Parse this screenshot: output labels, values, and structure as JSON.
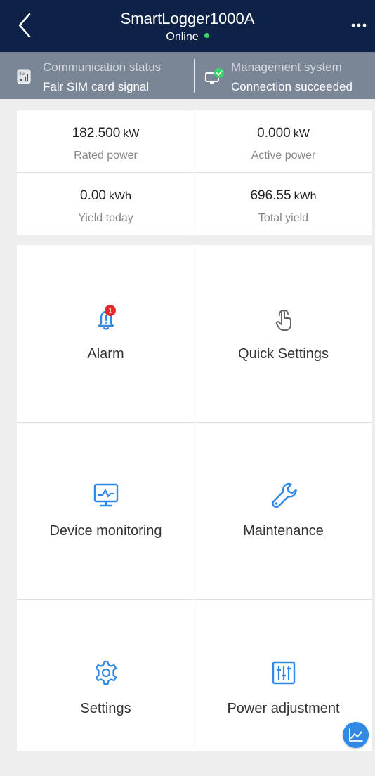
{
  "header": {
    "title": "SmartLogger1000A",
    "status": "Online",
    "status_color": "#3bd36b"
  },
  "info_bar": {
    "communication": {
      "label": "Communication status",
      "value": "Fair SIM card signal",
      "icon": "sim-signal-icon"
    },
    "management": {
      "label": "Management system",
      "value": "Connection succeeded",
      "icon": "management-connected-icon"
    }
  },
  "stats": [
    {
      "value": "182.500",
      "unit": "kW",
      "label": "Rated power"
    },
    {
      "value": "0.000",
      "unit": "kW",
      "label": "Active power"
    },
    {
      "value": "0.00",
      "unit": "kWh",
      "label": "Yield today"
    },
    {
      "value": "696.55",
      "unit": "kWh",
      "label": "Total yield"
    }
  ],
  "menu": [
    {
      "label": "Alarm",
      "icon": "bell-icon",
      "badge": "1"
    },
    {
      "label": "Quick Settings",
      "icon": "touch-icon"
    },
    {
      "label": "Device monitoring",
      "icon": "monitor-icon"
    },
    {
      "label": "Maintenance",
      "icon": "wrench-icon"
    },
    {
      "label": "Settings",
      "icon": "gear-icon"
    },
    {
      "label": "Power adjustment",
      "icon": "sliders-icon"
    }
  ],
  "colors": {
    "accent": "#2f89e5",
    "header_bg": "#0d2246",
    "badge": "#e8262d"
  }
}
